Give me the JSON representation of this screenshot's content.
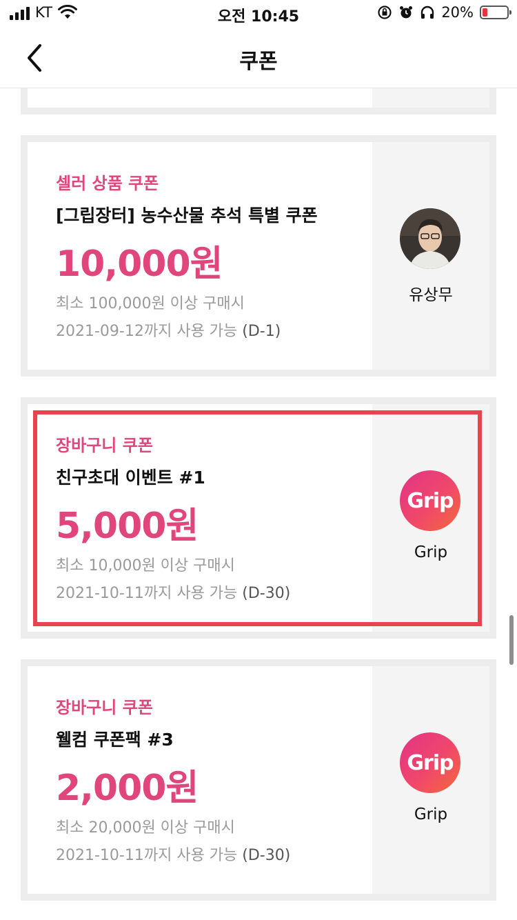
{
  "status_bar": {
    "carrier": "KT",
    "time": "오전 10:45",
    "battery_percent": "20%",
    "battery_level": 0.2
  },
  "header": {
    "title": "쿠폰",
    "back_icon": "chevron-left-icon"
  },
  "coupons": [
    {
      "type": "셀러 상품 쿠폰",
      "name": "[그립장터] 농수산물 추석 특별 쿠폰",
      "amount": "10,000원",
      "min_purchase": "최소 100,000원 이상 구매시",
      "expiry": "2021-09-12까지 사용 가능 ",
      "dday": "(D-1)",
      "seller": "유상무",
      "seller_logo": "avatar-photo"
    },
    {
      "type": "장바구니 쿠폰",
      "name": "친구초대 이벤트 #1",
      "amount": "5,000원",
      "min_purchase": "최소 10,000원 이상 구매시",
      "expiry": "2021-10-11까지 사용 가능 ",
      "dday": "(D-30)",
      "seller": "Grip",
      "seller_logo": "Grip",
      "highlighted": true
    },
    {
      "type": "장바구니 쿠폰",
      "name": "웰컴 쿠폰팩 #3",
      "amount": "2,000원",
      "min_purchase": "최소 20,000원 이상 구매시",
      "expiry": "2021-10-11까지 사용 가능 ",
      "dday": "(D-30)",
      "seller": "Grip",
      "seller_logo": "Grip"
    }
  ],
  "colors": {
    "accent": "#e0457b",
    "highlight_border": "#e8434f",
    "card_frame": "#ededed",
    "side_panel": "#f4f4f4"
  }
}
